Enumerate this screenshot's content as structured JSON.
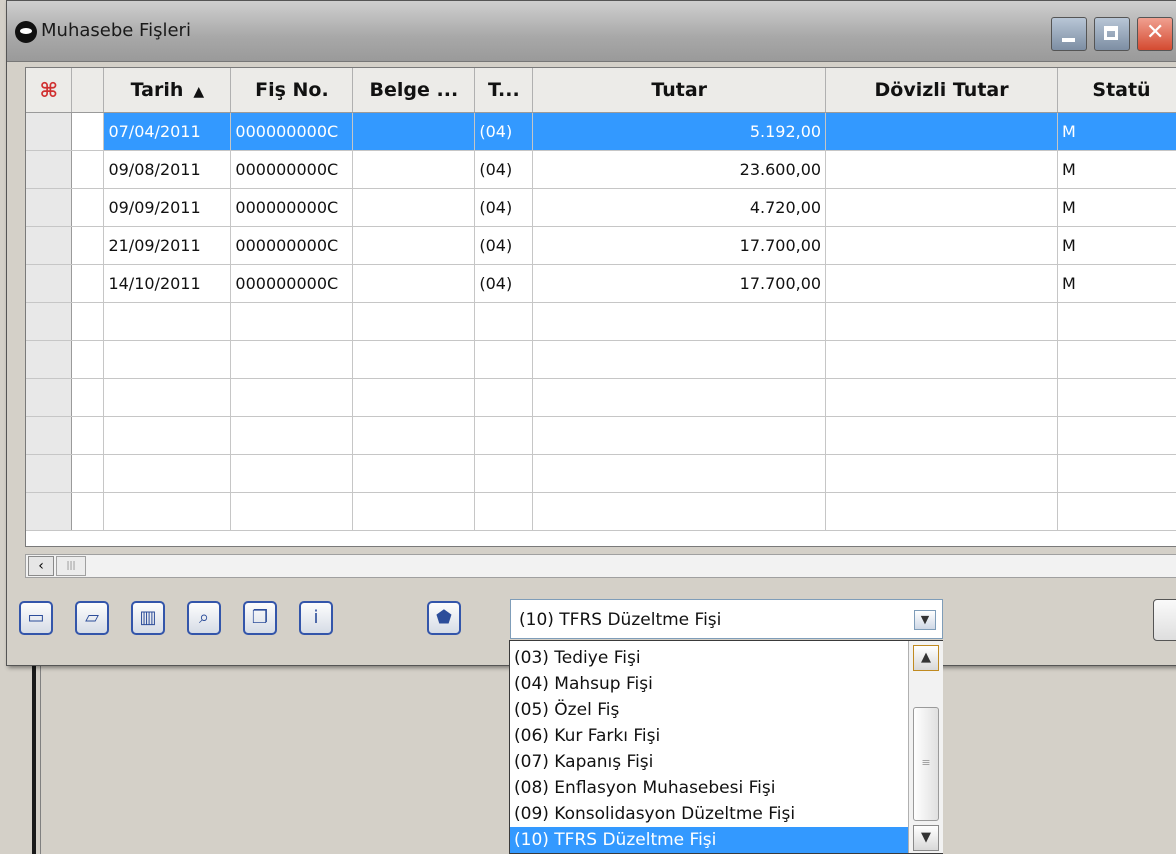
{
  "window": {
    "title": "Muhasebe Fişleri"
  },
  "grid": {
    "columns": [
      "Tarih",
      "Fiş No.",
      "Belge ...",
      "T...",
      "Tutar",
      "Dövizli Tutar",
      "Statü"
    ],
    "sort_indicator": "▲",
    "rows": [
      {
        "tarih": "07/04/2011",
        "fis_no": "000000000C",
        "belge": "",
        "tur": "(04)",
        "tutar": "5.192,00",
        "dovizli": "",
        "statu": "M",
        "selected": true
      },
      {
        "tarih": "09/08/2011",
        "fis_no": "000000000C",
        "belge": "",
        "tur": "(04)",
        "tutar": "23.600,00",
        "dovizli": "",
        "statu": "M"
      },
      {
        "tarih": "09/09/2011",
        "fis_no": "000000000C",
        "belge": "",
        "tur": "(04)",
        "tutar": "4.720,00",
        "dovizli": "",
        "statu": "M"
      },
      {
        "tarih": "21/09/2011",
        "fis_no": "000000000C",
        "belge": "",
        "tur": "(04)",
        "tutar": "17.700,00",
        "dovizli": "",
        "statu": "M"
      },
      {
        "tarih": "14/10/2011",
        "fis_no": "000000000C",
        "belge": "",
        "tur": "(04)",
        "tutar": "17.700,00",
        "dovizli": "",
        "statu": "M"
      }
    ],
    "empty_rows": 6
  },
  "toolbar": {
    "icons": [
      "new-document-icon",
      "open-folder-icon",
      "trash-icon",
      "preview-icon",
      "copy-icon",
      "info-icon",
      "filter-icon"
    ]
  },
  "fis_type": {
    "selected": "(10) TFRS Düzeltme Fişi",
    "options": [
      "(03) Tediye Fişi",
      "(04) Mahsup Fişi",
      "(05) Özel Fiş",
      "(06) Kur Farkı Fişi",
      "(07) Kapanış Fişi",
      "(08) Enflasyon Muhasebesi Fişi",
      "(09) Konsolidasyon Düzeltme Fişi",
      "(10) TFRS Düzeltme Fişi"
    ],
    "selected_index": 7
  },
  "colors": {
    "selection": "#3399ff",
    "window_bg": "#d4d0c8"
  }
}
